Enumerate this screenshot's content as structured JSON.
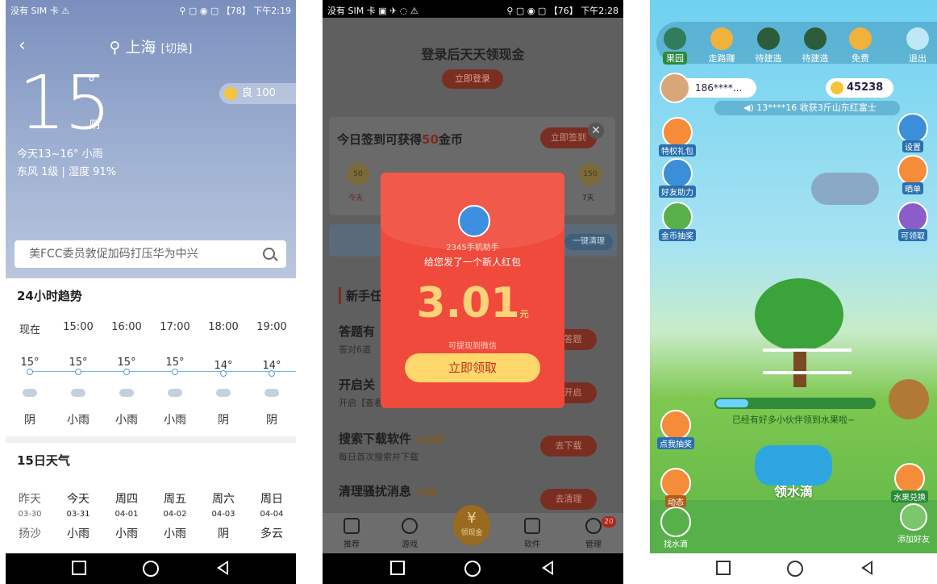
{
  "screen1": {
    "status_left": "没有 SIM 卡 ⚠",
    "status_right": "⚲ ▢ ◉ ▢ 【78】 下午2:19",
    "back_label": "‹",
    "city": "上海",
    "switch_label": "[切换]",
    "temperature": "15",
    "degree": "°",
    "condition": "阴",
    "aqi_label": "良 100",
    "today_line": "今天13~16°   小雨",
    "wind_line": "东风 1级 | 湿度 91%",
    "search_text": "美FCC委员敦促加码打压华为中兴",
    "hourly_title": "24小时趋势",
    "hourly": [
      {
        "time": "现在",
        "temp": "15°",
        "weather": "阴"
      },
      {
        "time": "15:00",
        "temp": "15°",
        "weather": "小雨"
      },
      {
        "time": "16:00",
        "temp": "15°",
        "weather": "小雨"
      },
      {
        "time": "17:00",
        "temp": "15°",
        "weather": "小雨"
      },
      {
        "time": "18:00",
        "temp": "14°",
        "weather": "阴"
      },
      {
        "time": "19:00",
        "temp": "14°",
        "weather": "阴"
      }
    ],
    "daily_title": "15日天气",
    "daily": [
      {
        "day": "昨天",
        "date": "03-30",
        "weather": "扬沙"
      },
      {
        "day": "今天",
        "date": "03-31",
        "weather": "小雨"
      },
      {
        "day": "周四",
        "date": "04-01",
        "weather": "小雨"
      },
      {
        "day": "周五",
        "date": "04-02",
        "weather": "小雨"
      },
      {
        "day": "周六",
        "date": "04-03",
        "weather": "阴"
      },
      {
        "day": "周日",
        "date": "04-04",
        "weather": "多云"
      }
    ]
  },
  "screen2": {
    "status_left": "没有 SIM 卡 ▣ ✈ ◌ ⚠",
    "status_right": "⚲ ▢ ◉ ▢ 【76】 下午2:28",
    "title": "登录后天天领现金",
    "login_button": "立即登录",
    "sign_title_prefix": "今日签到可获得",
    "sign_title_number": "50",
    "sign_title_suffix": "金币",
    "sign_button": "立即签到",
    "sign_coins": [
      "50",
      "",
      "",
      "",
      "",
      "",
      "150"
    ],
    "sign_days_first": "今天",
    "sign_days_last": "7天",
    "clean_button": "一键清理",
    "newbie_title": "新手任",
    "tasks": [
      {
        "title": "答题有",
        "desc": "答对6道",
        "button": "去答题"
      },
      {
        "title": "开启关",
        "desc": "开启【查看应用使用情况】权限",
        "button": "去开启"
      },
      {
        "title": "搜索下载软件",
        "badge": "+150",
        "desc": "每日首次搜索并下载",
        "button": "去下载"
      },
      {
        "title": "清理骚扰消息",
        "badge": "+20",
        "desc": "清理垃圾消息，不再受打扰",
        "button": "去清理"
      }
    ],
    "redpacket": {
      "from": "2345手机助手",
      "line": "给您发了一个新人红包",
      "amount": "3.01",
      "unit": "元",
      "hint": "可提现到微信",
      "button": "立即领取"
    },
    "tabs": [
      "推荐",
      "游戏",
      "领现金",
      "软件",
      "管理"
    ],
    "manage_badge": "20"
  },
  "screen3": {
    "top_items": [
      "果园",
      "走路赚",
      "待建造",
      "待建造",
      "免费"
    ],
    "exit_label": "退出",
    "user_name": "186****...",
    "coin_count": "45238",
    "ticker": "13****16 收获3斤山东红富士",
    "left_items": [
      "特权礼包",
      "好友助力",
      "金币抽奖"
    ],
    "right_items": [
      "设置",
      "晒单",
      "可领取"
    ],
    "progress_msg": "已经有好多小伙伴领到水果啦~",
    "lottery_label": "点我抽奖",
    "water_label": "领水滴",
    "dynamic_label": "动态",
    "exchange_label": "水果兑换",
    "find_water_label": "找水滴",
    "add_friend_label": "添加好友"
  }
}
